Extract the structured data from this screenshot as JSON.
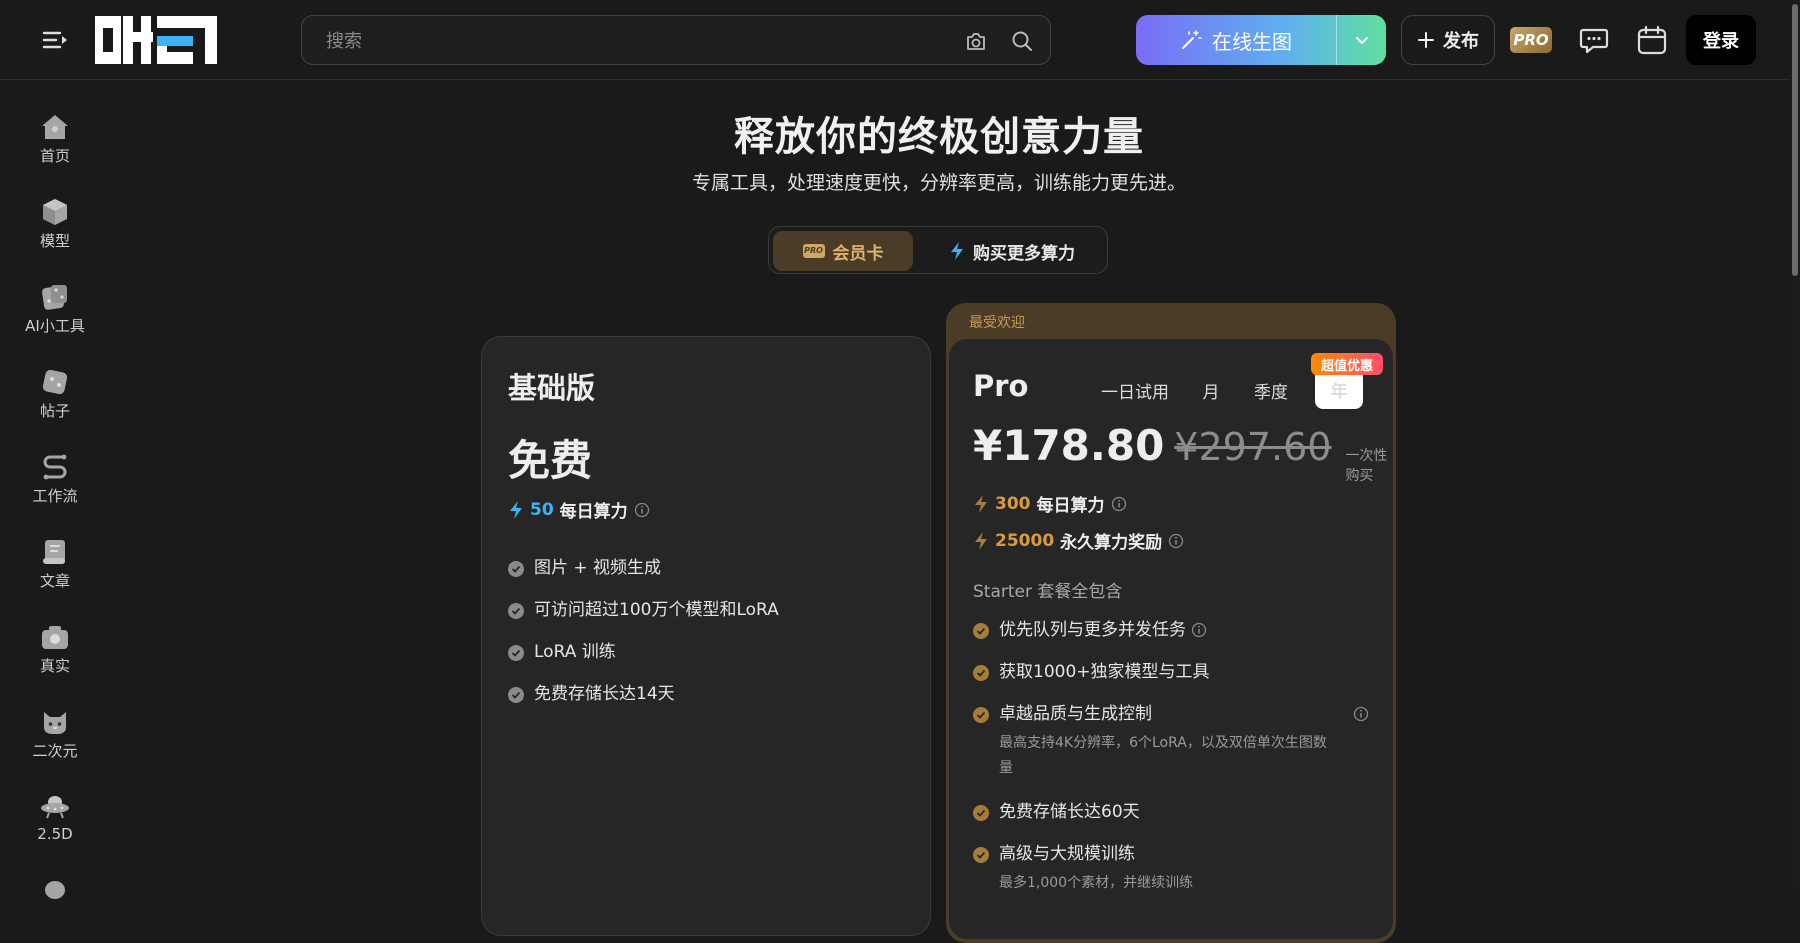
{
  "header": {
    "search_placeholder": "搜索",
    "generate_label": "在线生图",
    "publish_label": "发布",
    "pro_badge": "PRO",
    "login_label": "登录",
    "accent_gradient": [
      "#7b6cf7",
      "#5fb0f0",
      "#5ee0a0"
    ]
  },
  "sidebar": {
    "items": [
      {
        "label": "首页",
        "icon": "home-icon"
      },
      {
        "label": "模型",
        "icon": "cube-icon"
      },
      {
        "label": "AI小工具",
        "icon": "dice-icon"
      },
      {
        "label": "帖子",
        "icon": "post-icon"
      },
      {
        "label": "工作流",
        "icon": "workflow-icon"
      },
      {
        "label": "文章",
        "icon": "scroll-icon"
      },
      {
        "label": "真实",
        "icon": "camera-icon"
      },
      {
        "label": "二次元",
        "icon": "cat-icon"
      },
      {
        "label": "2.5D",
        "icon": "ufo-icon"
      }
    ]
  },
  "hero": {
    "title": "释放你的终极创意力量",
    "subtitle": "专属工具，处理速度更快，分辨率更高，训练能力更先进。"
  },
  "switcher": {
    "membership": "会员卡",
    "membership_chip": "PRO",
    "buy_compute": "购买更多算力"
  },
  "free_plan": {
    "name": "基础版",
    "price": "免费",
    "daily_amount": "50",
    "daily_label": "每日算力",
    "features": [
      "图片 + 视频生成",
      "可访问超过100万个模型和LoRA",
      "LoRA 训练",
      "免费存储长达14天"
    ]
  },
  "pro_plan": {
    "popular": "最受欢迎",
    "name": "Pro",
    "periods": [
      "一日试用",
      "月",
      "季度",
      "年"
    ],
    "deal_badge": "超值优惠",
    "price_now": "¥178.80",
    "price_old": "¥297.60",
    "price_note": "一次性购买",
    "daily_amount": "300",
    "daily_label": "每日算力",
    "bonus_amount": "25000",
    "bonus_label": "永久算力奖励",
    "includes": "Starter 套餐全包含",
    "features": [
      {
        "title": "优先队列与更多并发任务",
        "sub": ""
      },
      {
        "title": "获取1000+独家模型与工具",
        "sub": ""
      },
      {
        "title": "卓越品质与生成控制",
        "sub": "最高支持4K分辨率，6个LoRA，以及双倍单次生图数量"
      },
      {
        "title": "免费存储长达60天",
        "sub": ""
      },
      {
        "title": "高级与大规模训练",
        "sub": "最多1,000个素材，并继续训练"
      }
    ]
  }
}
